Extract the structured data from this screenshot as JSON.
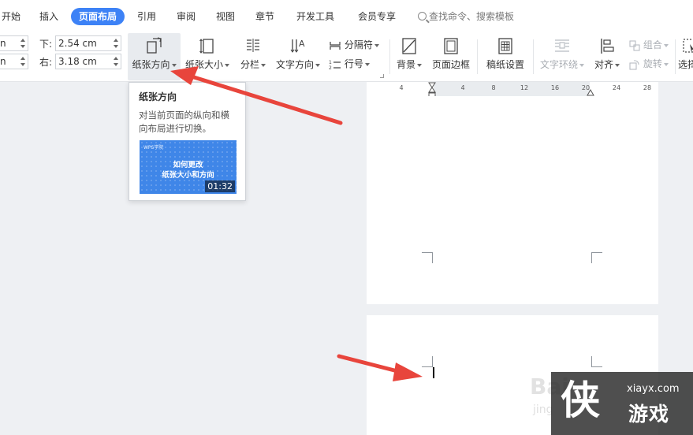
{
  "menu": {
    "tabs": [
      "开始",
      "插入",
      "页面布局",
      "引用",
      "审阅",
      "视图",
      "章节",
      "开发工具",
      "会员专享"
    ],
    "active_tab": "页面布局",
    "search_placeholder": "查找命令、搜索模板"
  },
  "margins": {
    "left_cut_top": "n",
    "left_cut_bottom": "n",
    "bottom_label": "下:",
    "bottom_value": "2.54 cm",
    "right_label": "右:",
    "right_value": "3.18 cm"
  },
  "ribbon": {
    "orientation": "纸张方向",
    "size": "纸张大小",
    "columns": "分栏",
    "text_direction": "文字方向",
    "separator": "分隔符",
    "line_number": "行号",
    "background": "背景",
    "page_border": "页面边框",
    "manuscript": "稿纸设置",
    "text_wrap": "文字环绕",
    "align": "对齐",
    "group": "组合",
    "rotate": "旋转",
    "select": "选择"
  },
  "ruler_ticks": [
    "4",
    "4",
    "8",
    "12",
    "16",
    "20",
    "24",
    "28"
  ],
  "tooltip": {
    "title": "纸张方向",
    "description": "对当前页面的纵向和横向布局进行切换。",
    "thumb_brand": "WPS学院",
    "thumb_line1": "如何更改",
    "thumb_line2": "纸张大小和方向",
    "duration": "01:32"
  },
  "watermark": {
    "baidu": "Bai",
    "baidu_sub": "jing",
    "logo_char": "侠",
    "logo_url": "xiayx.com",
    "logo_text": "游戏"
  },
  "colors": {
    "accent": "#3d82f6",
    "arrow": "#e8453c"
  }
}
